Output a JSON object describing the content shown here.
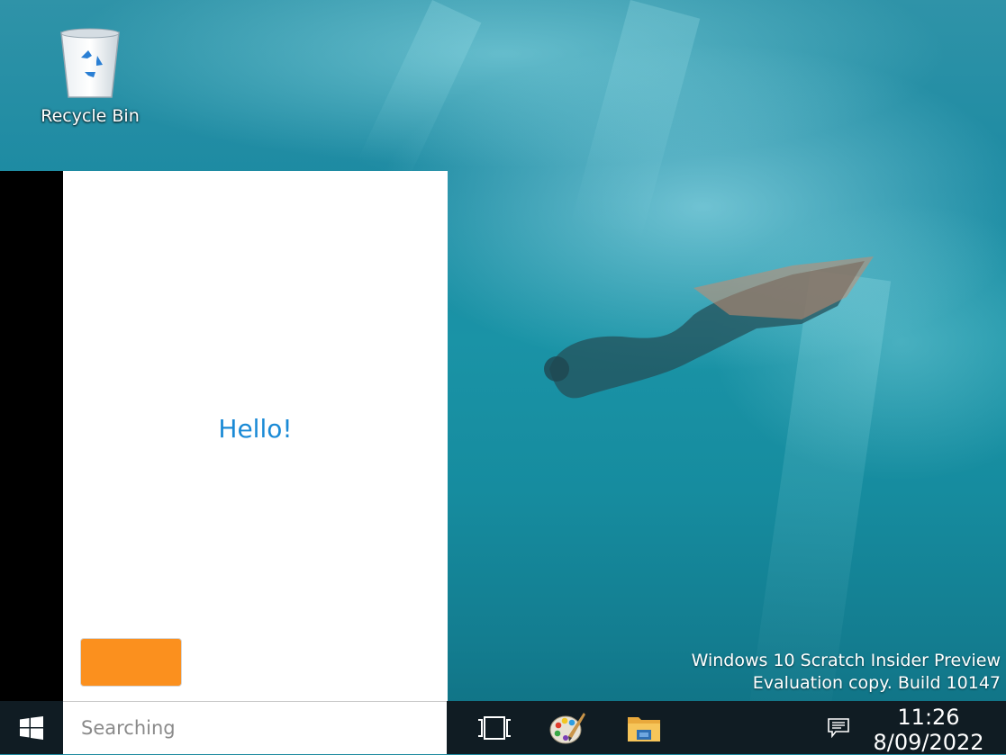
{
  "desktop": {
    "icons": [
      {
        "label": "Recycle Bin",
        "icon": "recycle-bin-icon"
      }
    ],
    "watermark": {
      "line1": "Windows 10 Scratch Insider Preview",
      "line2": "Evaluation copy. Build 10147"
    }
  },
  "start_menu": {
    "greeting": "Hello!",
    "action_button_label": "",
    "accent_color": "#fb901e",
    "greeting_color": "#1a8ad6"
  },
  "taskbar": {
    "start_icon": "windows-logo-icon",
    "search": {
      "placeholder": "Searching",
      "value": ""
    },
    "pinned": [
      {
        "name": "task-view",
        "icon": "task-view-icon"
      },
      {
        "name": "paint",
        "icon": "paint-palette-icon"
      },
      {
        "name": "file-explorer",
        "icon": "folder-icon"
      }
    ],
    "tray": {
      "notification_icon": "action-center-icon",
      "time": "11:26",
      "date": "8/09/2022"
    }
  }
}
